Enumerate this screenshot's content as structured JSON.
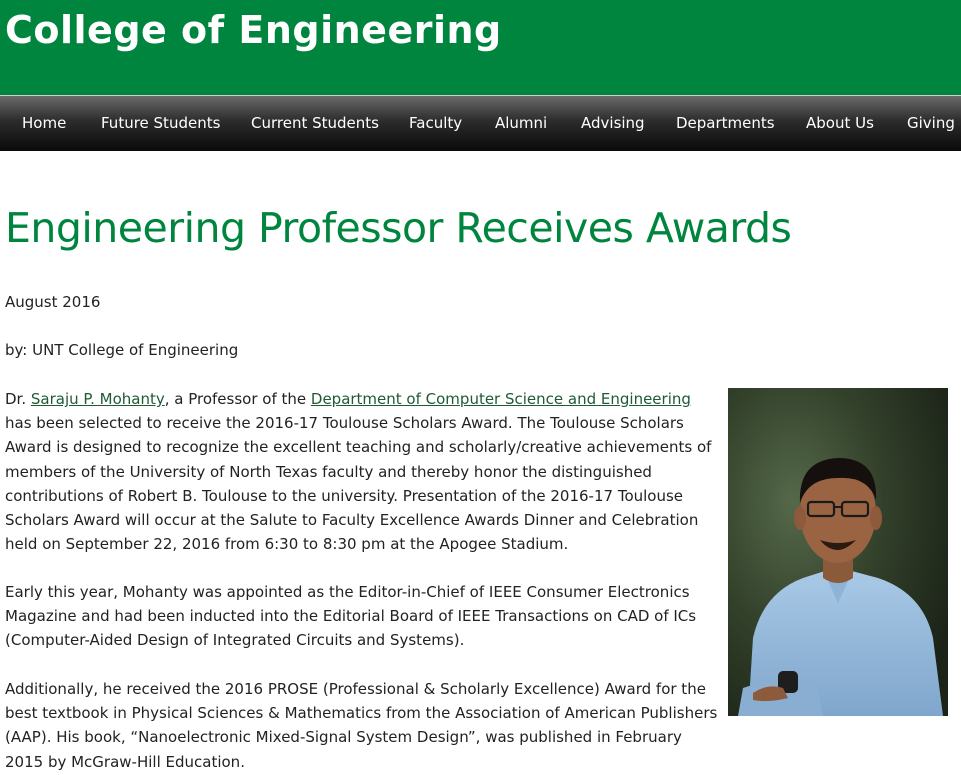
{
  "site": {
    "title": "College of Engineering"
  },
  "nav": {
    "items": [
      "Home",
      "Future Students",
      "Current Students",
      "Faculty",
      "Alumni",
      "Advising",
      "Departments",
      "About Us",
      "Giving"
    ]
  },
  "article": {
    "title": "Engineering Professor Receives Awards",
    "date": "August 2016",
    "byline": "by: UNT College of Engineering",
    "p1": {
      "prefix": "Dr. ",
      "link_person": "Saraju P. Mohanty",
      "middle": ", a Professor of the ",
      "link_department": "Department of Computer Science and Engineering",
      "rest": " has been selected to receive the 2016-17 Toulouse Scholars Award. The Toulouse Scholars Award is designed to recognize the excellent teaching and scholarly/creative achievements of members of the University of North Texas faculty and thereby honor the distinguished contributions of Robert B. Toulouse to the university. Presentation of the 2016-17 Toulouse Scholars Award will occur at the Salute to Faculty Excellence Awards Dinner and Celebration held on September 22, 2016 from 6:30 to 8:30 pm at the Apogee Stadium."
    },
    "p2": "Early this year, Mohanty was appointed as the Editor-in-Chief of IEEE Consumer Electronics Magazine and had been inducted into the Editorial Board of IEEE Transactions on CAD of ICs (Computer-Aided Design of Integrated Circuits and Systems).",
    "p3": "Additionally, he received the 2016 PROSE (Professional & Scholarly Excellence) Award for the best textbook in Physical Sciences & Mathematics from the Association of American Publishers (AAP). His book, “Nanoelectronic Mixed-Signal System Design”, was published in February 2015 by McGraw-Hill Education."
  },
  "colors": {
    "brand_green": "#00853e",
    "nav_dark": "#1a1a1a",
    "link": "#1f5a33",
    "text": "#222222"
  }
}
